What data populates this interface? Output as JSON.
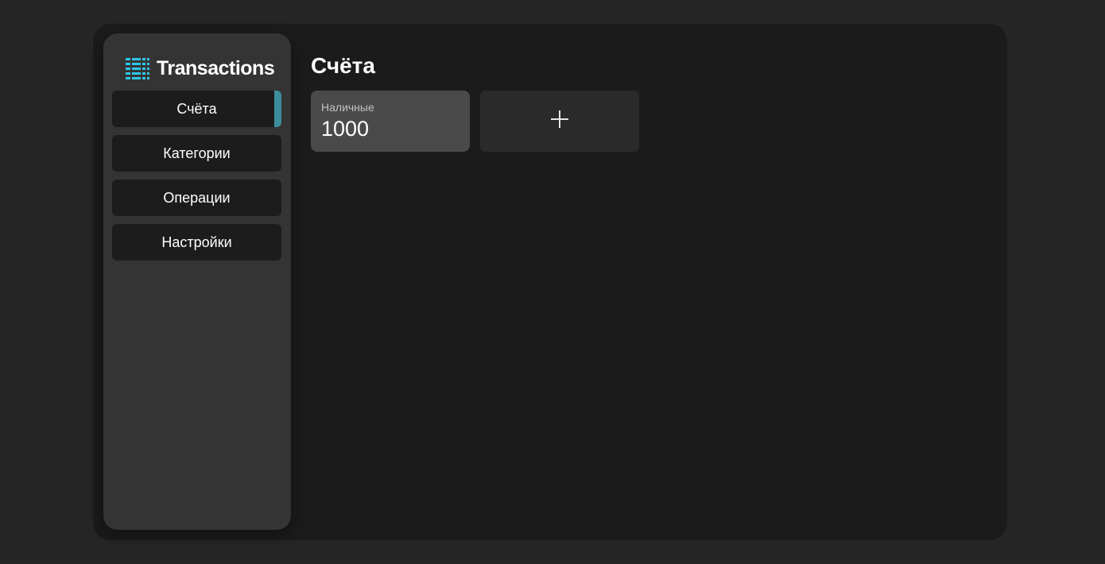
{
  "brand": {
    "title": "Transactions",
    "icon": "list-icon",
    "icon_color": "#2ec6e6"
  },
  "sidebar": {
    "items": [
      {
        "label": "Счёта",
        "active": true
      },
      {
        "label": "Категории",
        "active": false
      },
      {
        "label": "Операции",
        "active": false
      },
      {
        "label": "Настройки",
        "active": false
      }
    ],
    "active_indicator_color": "#3d8e9b"
  },
  "main": {
    "title": "Счёта",
    "accounts": [
      {
        "name": "Наличные",
        "amount": "1000"
      }
    ],
    "add_icon": "plus-icon"
  }
}
